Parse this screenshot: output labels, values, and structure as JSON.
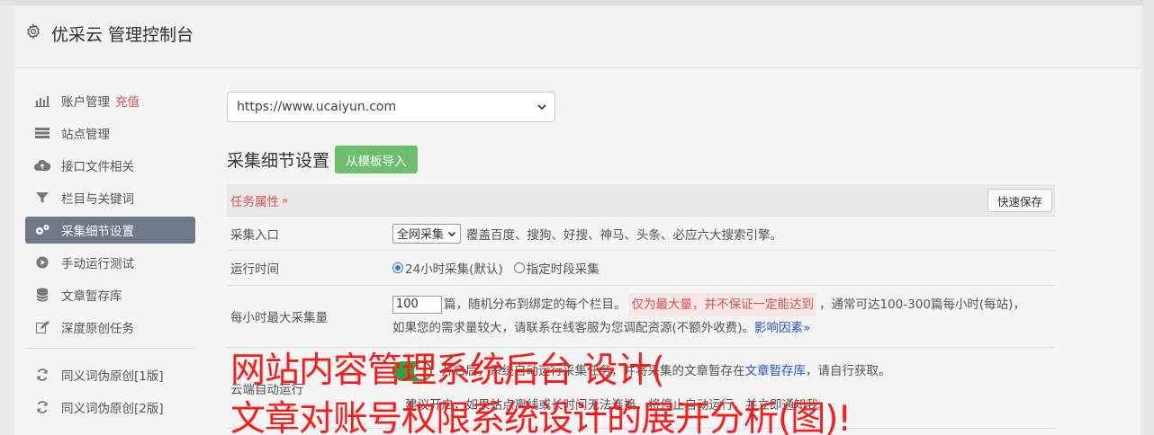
{
  "header": {
    "title": "优采云 管理控制台",
    "icon": "gear-icon"
  },
  "sidebar": {
    "items": [
      {
        "label": "账户管理",
        "extra": "充值",
        "icon": "bar-chart-icon"
      },
      {
        "label": "站点管理",
        "icon": "server-icon"
      },
      {
        "label": "接口文件相关",
        "icon": "cloud-upload-icon"
      },
      {
        "label": "栏目与关键词",
        "icon": "filter-icon"
      },
      {
        "label": "采集细节设置",
        "icon": "cogs-icon",
        "active": true
      },
      {
        "label": "手动运行测试",
        "icon": "play-circle-icon"
      },
      {
        "label": "文章暂存库",
        "icon": "database-icon"
      },
      {
        "label": "深度原创任务",
        "icon": "edit-icon"
      }
    ],
    "items2": [
      {
        "label": "同义词伪原创[1版]",
        "icon": "refresh-icon"
      },
      {
        "label": "同义词伪原创[2版]",
        "icon": "refresh-icon"
      }
    ]
  },
  "site_select": {
    "value": "https://www.ucaiyun.com"
  },
  "section": {
    "title": "采集细节设置",
    "import_button": "从模板导入"
  },
  "table": {
    "head": {
      "attr_label": "任务属性",
      "attr_chev": "»",
      "quick_save": "快速保存"
    },
    "rows": {
      "entry": {
        "label": "采集入口",
        "select": "全网采集",
        "desc": "覆盖百度、搜狗、好搜、神马、头条、必应六大搜索引擎。"
      },
      "time": {
        "label": "运行时间",
        "opt1": "24小时采集(默认)",
        "opt2": "指定时段采集"
      },
      "max": {
        "label": "每小时最大采集量",
        "value": "100",
        "t1": "篇，随机分布到绑定的每个栏目。",
        "warn": "仅为最大量，并不保证一定能达到",
        "t2": "，通常可达100-300篇每小时(每站)，",
        "t3": "如果您的需求量较大，请联系在线客服为您调配资源(不额外收费)。",
        "link": "影响因素",
        "link_chev": "»"
      },
      "cloud": {
        "label": "云端自动运行",
        "t1": "开启后，系统自动运行采集任务，并将采集的文章暂存在",
        "link": "文章暂存库",
        "t2": "，请自行获取。",
        "t3": "建议开启，如果站点离线或长时间无法连接，将停止自动运行，并立即通知我。"
      }
    }
  },
  "overlay": {
    "line1": "网站内容管理系统后台 设计(",
    "line2": "文章对账号权限系统设计的展开分析(图)!"
  },
  "colors": {
    "accent_red": "#d9534f",
    "green": "#6cbf6c",
    "active_bg": "#6e7a8a",
    "overlay_red": "#ff1a1a"
  }
}
